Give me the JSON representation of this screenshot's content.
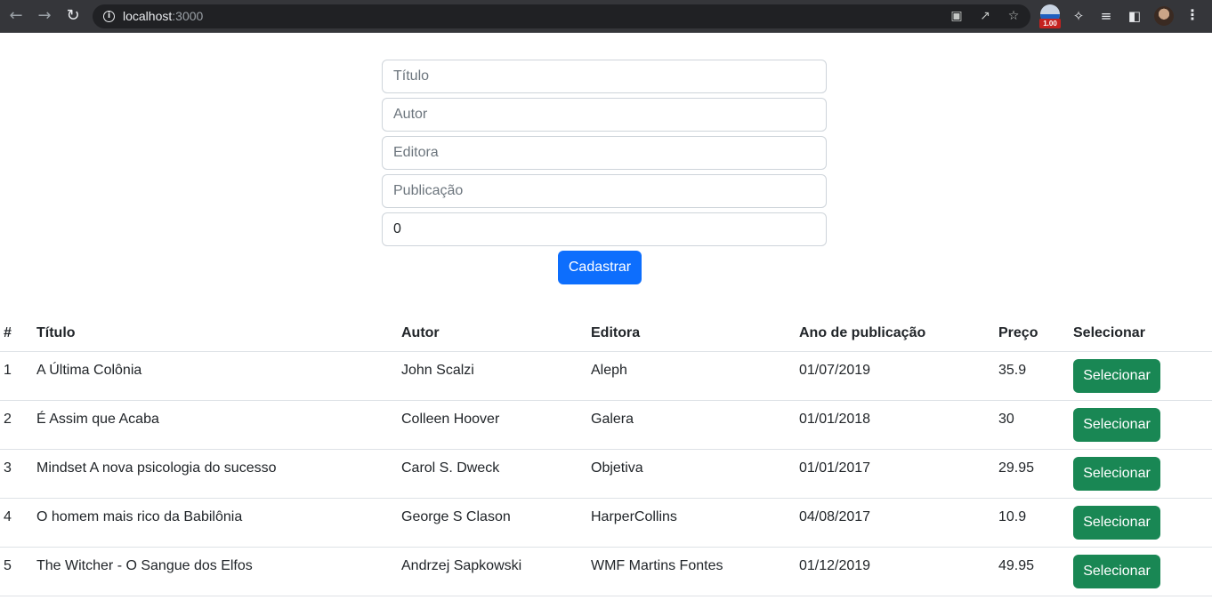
{
  "browser": {
    "url_host": "localhost",
    "url_port": ":3000",
    "extension_badge": "1.00",
    "icons": [
      "back-icon",
      "forward-icon",
      "reload-icon",
      "info-icon",
      "translate-icon",
      "share-icon",
      "star-icon",
      "extensions-icon",
      "reading-list-icon",
      "side-panel-icon",
      "kebab-menu-icon"
    ]
  },
  "form": {
    "fields": [
      {
        "placeholder": "Título",
        "value": ""
      },
      {
        "placeholder": "Autor",
        "value": ""
      },
      {
        "placeholder": "Editora",
        "value": ""
      },
      {
        "placeholder": "Publicação",
        "value": ""
      },
      {
        "placeholder": "",
        "value": "0"
      }
    ],
    "submit_label": "Cadastrar"
  },
  "table": {
    "headers": [
      "#",
      "Título",
      "Autor",
      "Editora",
      "Ano de publicação",
      "Preço",
      "Selecionar"
    ],
    "rows": [
      {
        "id": "1",
        "title": "A Última Colônia",
        "author": "John Scalzi",
        "publisher": "Aleph",
        "date": "01/07/2019",
        "price": "35.9",
        "action": "Selecionar"
      },
      {
        "id": "2",
        "title": "É Assim que Acaba",
        "author": "Colleen Hoover",
        "publisher": "Galera",
        "date": "01/01/2018",
        "price": "30",
        "action": "Selecionar"
      },
      {
        "id": "3",
        "title": "Mindset A nova psicologia do sucesso",
        "author": "Carol S. Dweck",
        "publisher": "Objetiva",
        "date": "01/01/2017",
        "price": "29.95",
        "action": "Selecionar"
      },
      {
        "id": "4",
        "title": "O homem mais rico da Babilônia",
        "author": "George S Clason",
        "publisher": "HarperCollins",
        "date": "04/08/2017",
        "price": "10.9",
        "action": "Selecionar"
      },
      {
        "id": "5",
        "title": "The Witcher - O Sangue dos Elfos",
        "author": "Andrzej Sapkowski",
        "publisher": "WMF Martins Fontes",
        "date": "01/12/2019",
        "price": "49.95",
        "action": "Selecionar"
      }
    ]
  },
  "colors": {
    "primary": "#0d6efd",
    "success": "#198754",
    "chrome_bg": "#35363a",
    "omnibox_bg": "#202124"
  }
}
